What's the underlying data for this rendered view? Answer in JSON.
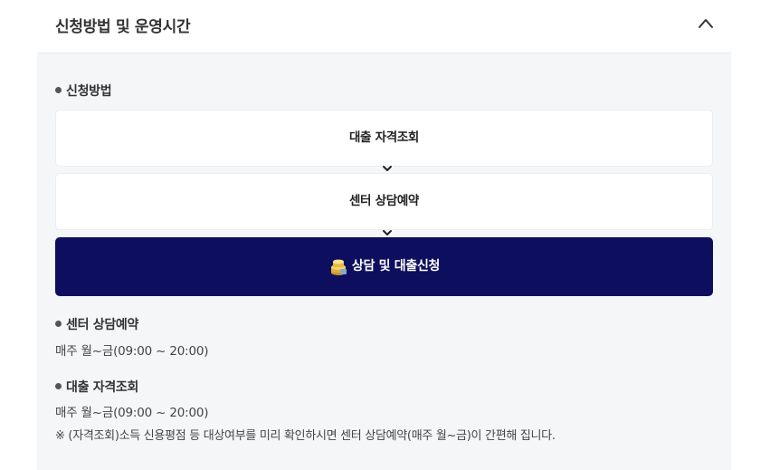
{
  "panel": {
    "title": "신청방법 및 운영시간",
    "collapse_icon": "chevron-up-icon"
  },
  "apply_method": {
    "label": "신청방법",
    "steps": [
      {
        "label": "대출 자격조회"
      },
      {
        "label": "센터 상담예약"
      }
    ],
    "step_arrow_icon": "chevron-down-icon",
    "apply_button": {
      "label": "상담 및 대출신청",
      "icon": "coin-stack-icon",
      "color": "#0d0f5e"
    }
  },
  "center_booking": {
    "label": "센터 상담예약",
    "hours": "매주 월~금(09:00 ~ 20:00)"
  },
  "eligibility": {
    "label": "대출 자격조회",
    "hours": "매주 월~금(09:00 ~ 20:00)",
    "note": "※ (자격조회)소득 신용평점 등 대상여부를 미리 확인하시면 센터 상담예약(매주 월~금)이 간편해 집니다."
  }
}
